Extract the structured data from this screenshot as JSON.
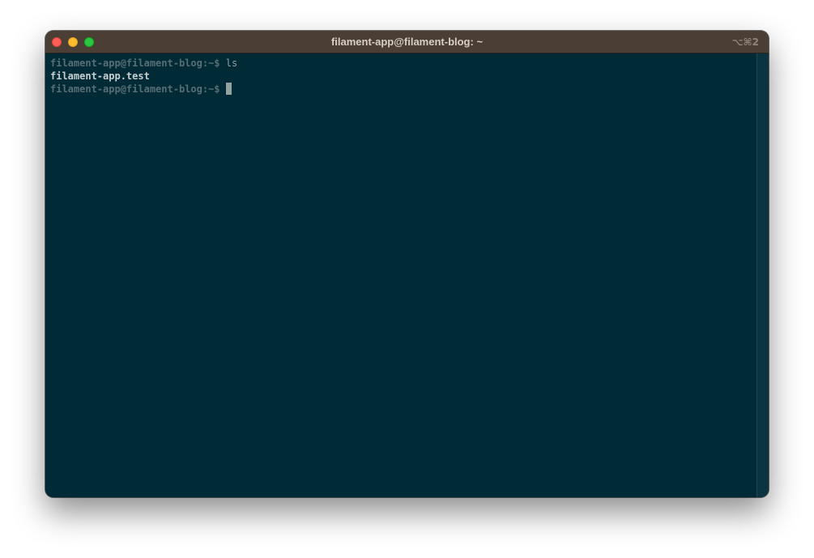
{
  "window": {
    "title": "filament-app@filament-blog: ~",
    "shortcut": "⌥⌘2"
  },
  "terminal": {
    "lines": [
      {
        "prompt": "filament-app@filament-blog:~$ ",
        "command": "ls"
      },
      {
        "output": "filament-app.test"
      },
      {
        "prompt": "filament-app@filament-blog:~$ ",
        "command": ""
      }
    ]
  },
  "colors": {
    "background": "#002b36",
    "titlebar": "#4a3e35",
    "prompt": "#586e75",
    "command": "#93a1a1",
    "output": "#c7d0d1"
  }
}
